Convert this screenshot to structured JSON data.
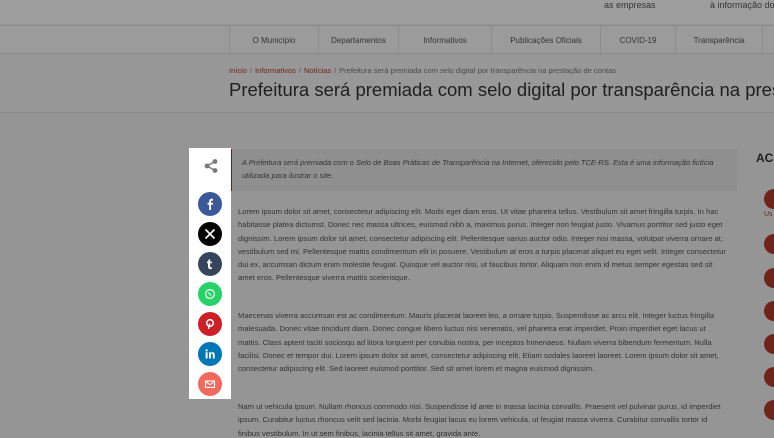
{
  "top_links": [
    "as empresas",
    "à informação do"
  ],
  "nav": {
    "items": [
      "O Município",
      "Departamentos",
      "Informativos",
      "Publicações Oficiais",
      "COVID-19",
      "Transparência"
    ]
  },
  "breadcrumb": {
    "home": "Início",
    "section": "Informativos",
    "category": "Notícias",
    "current": "Prefeitura será premiada com selo digital por transparência na prestação de contas",
    "separator": "/"
  },
  "page_title": "Prefeitura será premiada com selo digital por transparência na prestação de contas",
  "article": {
    "lead": "A Prefeitura será premiada com o Selo de Boas Práticas de Transparência na Internet, oferecido pelo TCE-RS. Esta é uma informação fictícia utilizada para ilustrar o site.",
    "paragraphs": [
      "Lorem ipsum dolor sit amet, consectetur adipiscing elit. Morbi eget diam eros. Ut vitae pharetra tellus. Vestibulum sit amet fringilla turpis. In hac habitasse platea dictumst. Donec nec massa ultrices, euismod nibh a, maximus purus. Integer non feugiat justo. Vivamus porttitor sed justo eget dignissim. Lorem ipsum dolor sit amet, consectetur adipiscing elit. Pellentesque varius auctor odio. Integer nisi massa, volutpat viverra ornare at, vestibulum sed mi. Pellentesque mattis condimentum elit in posuere. Vestibulum at eros a turpis placerat aliquet eu eget velit. Integer consectetur dui ex, accumsan dictum enim molestie feugiat. Quisque vel auctor nisi, ut faucibus tortor. Aliquam non enim id metus semper egestas sed sit amet eros. Pellentesque viverra mattis scelerisque.",
      "Maecenas viverra accumsan est ac condimentum. Mauris placerat laoreet leo, a ornare turpis. Suspendisse ac arcu elit. Integer luctus fringilla malesuada. Donec vitae tincidunt diam. Donec congue libero luctus nisi venenatis, vel pharetra erat imperdiet. Proin imperdiet eget lacus ut mattis. Class aptent taciti sociosqu ad litora torquent per conubia nostra, per inceptos himenaeos. Nullam viverra bibendum fermentum. Nulla facilisi. Donec et tempor dui. Lorem ipsum dolor sit amet, consectetur adipiscing elit. Etiam sodales laoreet laoreet. Lorem ipsum dolor sit amet, consectetur adipiscing elit. Sed laoreet euismod porttitor. Sed sit amet lorem et magna euismod dignissim.",
      "Nam ut vehicula ipsum. Nullam rhoncus commodo nisi. Suspendisse id ante in massa lacinia convallis. Praesent vel pulvinar purus, id imperdiet ipsum. Curabitur luctus rhoncus velit sed lacinia. Morbi feugiat lacus eu lorem vehicula, ut feugiat massa viverra. Curabitur convallis tortor id finibus vestibulum. In ut sem finibus, lacinia tellus sit amet, gravida ante."
    ]
  },
  "sidebar": {
    "title": "ACE",
    "first_label": "Us"
  },
  "share": {
    "buttons": [
      {
        "name": "facebook-share-button",
        "icon": "facebook-icon",
        "color": "#3b5998"
      },
      {
        "name": "x-share-button",
        "icon": "x-icon",
        "color": "#000000"
      },
      {
        "name": "tumblr-share-button",
        "icon": "tumblr-icon",
        "color": "#35465c"
      },
      {
        "name": "whatsapp-share-button",
        "icon": "whatsapp-icon",
        "color": "#25d366"
      },
      {
        "name": "pinterest-share-button",
        "icon": "pinterest-icon",
        "color": "#cb2027"
      },
      {
        "name": "linkedin-share-button",
        "icon": "linkedin-icon",
        "color": "#0077b5"
      },
      {
        "name": "email-share-button",
        "icon": "email-icon",
        "color": "#f06a5e"
      }
    ]
  },
  "colors": {
    "accent": "#b23b2e",
    "overlay": "rgba(0,0,0,0.38)"
  }
}
